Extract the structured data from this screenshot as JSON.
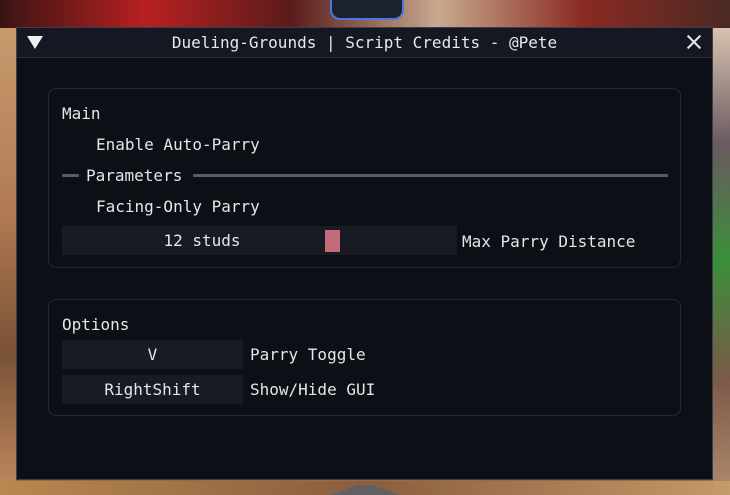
{
  "window": {
    "title": "Dueling-Grounds | Script Credits - @Pete"
  },
  "main_section": {
    "heading": "Main",
    "auto_parry_label": "Enable Auto-Parry",
    "parameters_label": "Parameters",
    "facing_only_label": "Facing-Only Parry",
    "slider": {
      "value_text": "12 studs",
      "label": "Max Parry Distance",
      "accent": "#c46a78"
    }
  },
  "options_section": {
    "heading": "Options",
    "keybinds": [
      {
        "key": "V",
        "label": "Parry Toggle"
      },
      {
        "key": "RightShift",
        "label": "Show/Hide GUI"
      }
    ]
  },
  "colors": {
    "window_bg": "#0d0f16",
    "titlebar_bg": "#151822",
    "control_bg": "#181a24",
    "text": "#e6e6e6"
  }
}
